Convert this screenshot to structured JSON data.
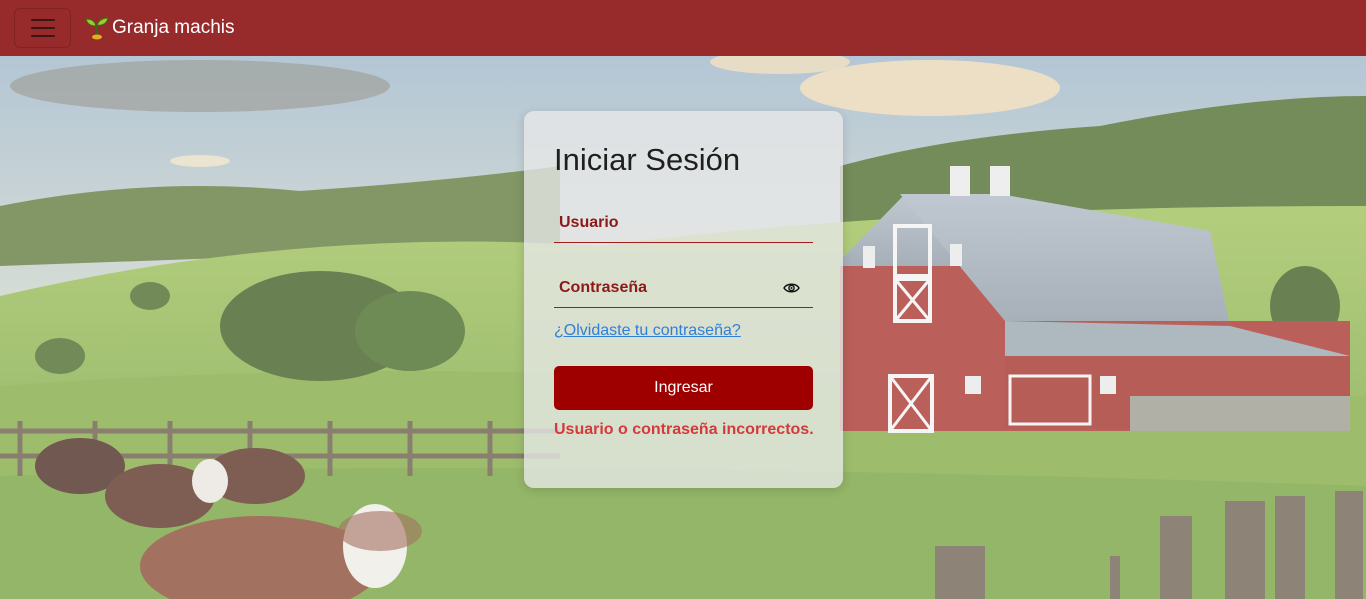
{
  "navbar": {
    "brand_name": "Granja machis",
    "brand_icon": "sprout-icon",
    "menu_icon": "hamburger-menu-icon",
    "background_color": "#972a2a"
  },
  "login": {
    "title": "Iniciar Sesión",
    "username_placeholder": "Usuario",
    "password_placeholder": "Contraseña",
    "show_password_icon": "eye-icon",
    "forgot_password_link": "¿Olvidaste tu contraseña?",
    "submit_label": "Ingresar",
    "error_message": "Usuario o contraseña incorrectos.",
    "accent_color": "#9e0000",
    "error_color": "#d43a3a"
  }
}
